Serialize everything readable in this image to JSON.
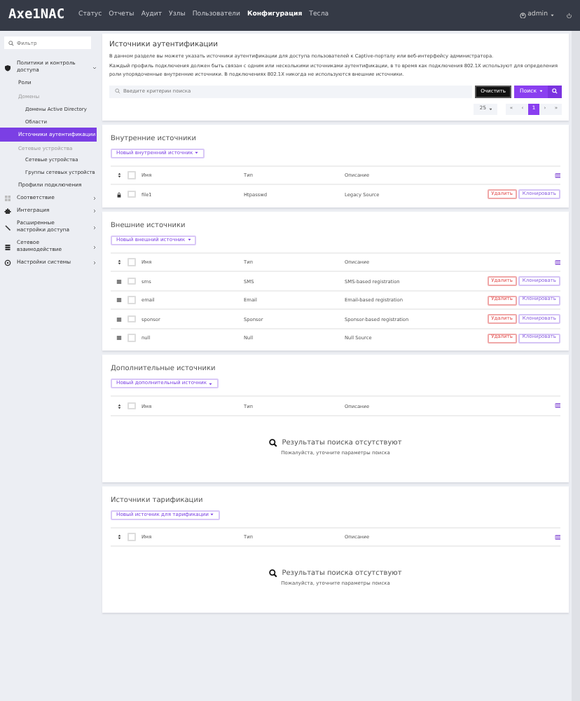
{
  "topbar": {
    "logo": "Axe1NAC",
    "nav": [
      {
        "label": "Статус",
        "selected": false
      },
      {
        "label": "Отчеты",
        "selected": false
      },
      {
        "label": "Аудит",
        "selected": false
      },
      {
        "label": "Узлы",
        "selected": false
      },
      {
        "label": "Пользователи",
        "selected": false
      },
      {
        "label": "Конфигурация",
        "selected": true
      },
      {
        "label": "Тесла",
        "selected": false
      }
    ],
    "user": "admin"
  },
  "sidebar": {
    "filter_placeholder": "Фильтр",
    "items": [
      {
        "kind": "group",
        "label": "Политики и контроль доступа",
        "expanded": true
      },
      {
        "kind": "item",
        "label": "Роли",
        "selected": false
      },
      {
        "kind": "header",
        "label": "Домены"
      },
      {
        "kind": "subitem",
        "label": "Домены Active Directory",
        "selected": false
      },
      {
        "kind": "subitem",
        "label": "Области",
        "selected": false
      },
      {
        "kind": "item",
        "label": "Источники аутентификации",
        "selected": true
      },
      {
        "kind": "header",
        "label": "Сетевые устройства"
      },
      {
        "kind": "subitem",
        "label": "Сетевые устройства",
        "selected": false
      },
      {
        "kind": "subitem",
        "label": "Группы сетевых устройств",
        "selected": false
      },
      {
        "kind": "item",
        "label": "Профили подключения",
        "selected": false
      },
      {
        "kind": "group",
        "label": "Соответствие",
        "expanded": false
      },
      {
        "kind": "group",
        "label": "Интеграция",
        "expanded": false
      },
      {
        "kind": "group",
        "label": "Расширенные настройки доступа",
        "expanded": false
      },
      {
        "kind": "group",
        "label": "Сетевое взаимодействие",
        "expanded": false
      },
      {
        "kind": "group",
        "label": "Настройки системы",
        "expanded": false
      }
    ]
  },
  "header": {
    "title": "Источники аутентификации",
    "paragraphs": [
      "В данном разделе вы можете указать источники аутентификации для доступа пользователей к Captive-порталу или веб-интерфейсу администратора.",
      "Каждый профиль подключения должен быть связан с одним или несколькими источниками аутентификации, в то время как подключения 802.1X используют для определения роли упорядоченные внутренние источники. В подключениях 802.1X никогда не используются внешние источники."
    ],
    "search_placeholder": "Введите критерии поиска",
    "clear_button": "Очистить",
    "search_button": "Поиск",
    "per_page": "25",
    "pages": [
      {
        "label": "«",
        "selected": false
      },
      {
        "label": "‹",
        "selected": false
      },
      {
        "label": "1",
        "selected": true
      },
      {
        "label": "›",
        "selected": false
      },
      {
        "label": "»",
        "selected": false
      }
    ]
  },
  "sections": [
    {
      "title": "Внутренние источники",
      "new_button": "Новый внутренний источник",
      "all_checked": false,
      "columns": [
        "Имя",
        "Тип",
        "Описание"
      ],
      "rows": [
        {
          "kind": "locked",
          "checked": false,
          "name": "file1",
          "type": "Htpasswd",
          "description": "Legacy Source",
          "delete": "Удалить",
          "clone": "Клонировать"
        }
      ]
    },
    {
      "title": "Внешние источники",
      "new_button": "Новый внешний источник",
      "all_checked": false,
      "columns": [
        "Имя",
        "Тип",
        "Описание"
      ],
      "rows": [
        {
          "kind": "draggable",
          "checked": false,
          "name": "sms",
          "type": "SMS",
          "description": "SMS-based registration",
          "delete": "Удалить",
          "clone": "Клонировать"
        },
        {
          "kind": "draggable",
          "checked": false,
          "name": "email",
          "type": "Email",
          "description": "Email-based registration",
          "delete": "Удалить",
          "clone": "Клонировать"
        },
        {
          "kind": "draggable",
          "checked": false,
          "name": "sponsor",
          "type": "Sponsor",
          "description": "Sponsor-based registration",
          "delete": "Удалить",
          "clone": "Клонировать"
        },
        {
          "kind": "draggable",
          "checked": false,
          "name": "null",
          "type": "Null",
          "description": "Null Source",
          "delete": "Удалить",
          "clone": "Клонировать"
        }
      ]
    },
    {
      "title": "Дополнительные источники",
      "new_button": "Новый дополнительный источник",
      "all_checked": false,
      "columns": [
        "Имя",
        "Тип",
        "Описание"
      ],
      "empty_title": "Результаты поиска отсутствуют",
      "empty_hint": "Пожалуйста, уточните параметры поиска"
    },
    {
      "title": "Источники тарификации",
      "new_button": "Новый источник для тарификации",
      "all_checked": false,
      "columns": [
        "Имя",
        "Тип",
        "Описание"
      ],
      "empty_title": "Результаты поиска отсутствуют",
      "empty_hint": "Пожалуйста, уточните параметры поиска"
    }
  ]
}
